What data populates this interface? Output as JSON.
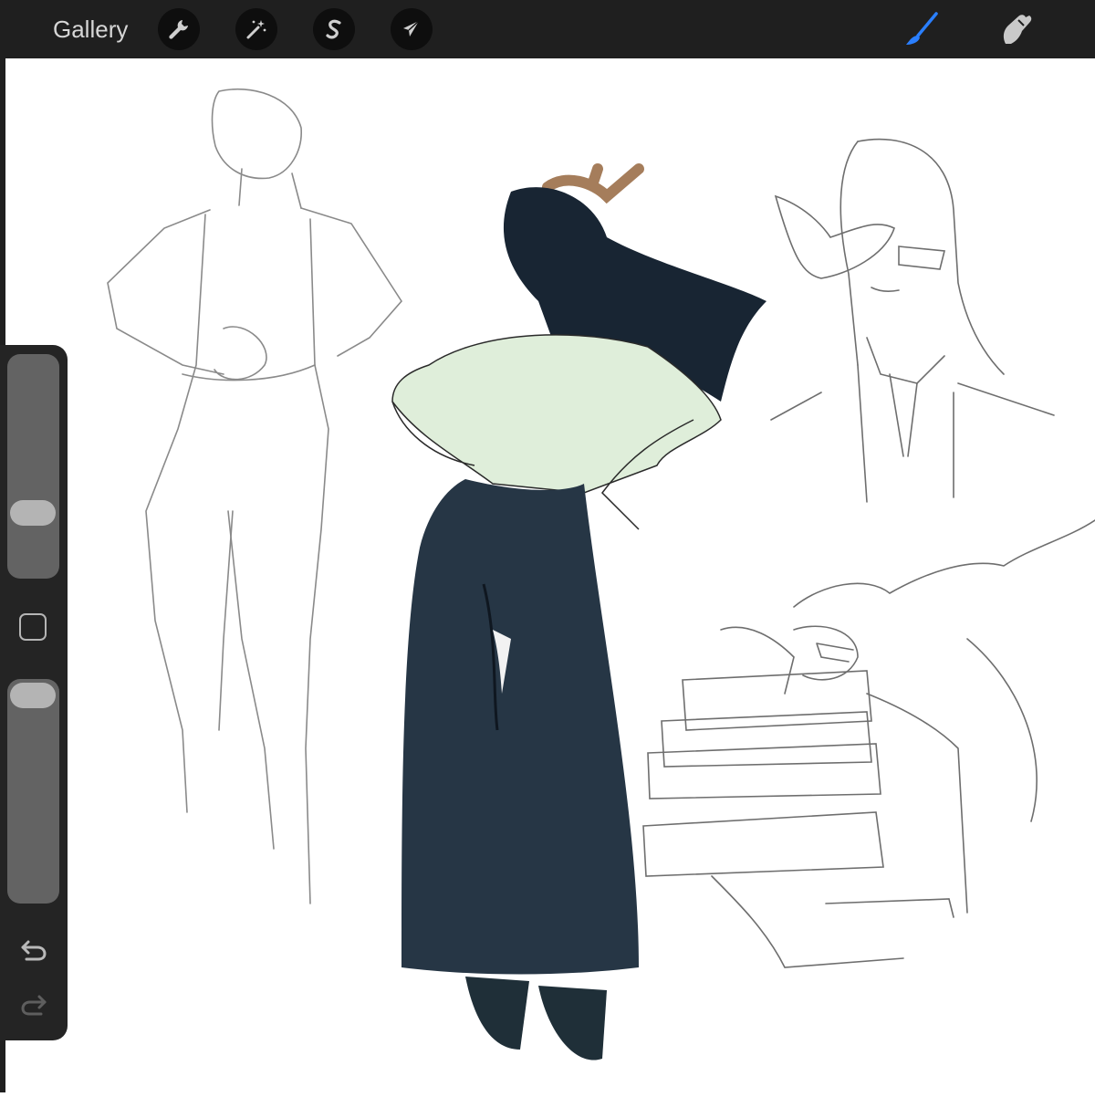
{
  "toolbar": {
    "gallery_label": "Gallery",
    "left_tools": [
      {
        "name": "actions",
        "icon": "wrench-icon"
      },
      {
        "name": "adjustments",
        "icon": "magic-wand-icon"
      },
      {
        "name": "selection",
        "icon": "selection-s-icon"
      },
      {
        "name": "transform",
        "icon": "arrow-cursor-icon"
      }
    ],
    "right_tools": [
      {
        "name": "brush",
        "icon": "brush-icon",
        "active": true
      },
      {
        "name": "smudge",
        "icon": "smudge-finger-icon",
        "active": false
      }
    ],
    "active_color": "#2a7fff"
  },
  "sidebar": {
    "brush_size_level": 0.2,
    "opacity_level": 1.0,
    "modifier_icon": "square-icon",
    "undo_icon": "undo-icon",
    "redo_icon": "redo-icon"
  },
  "canvas": {
    "artwork": "sketch-page"
  }
}
